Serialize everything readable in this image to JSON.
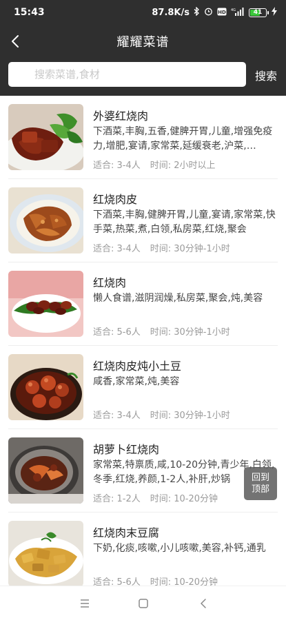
{
  "status_bar": {
    "time": "15:43",
    "net_speed": "87.8K/s",
    "battery": "41",
    "icons": [
      "bluetooth-icon",
      "alarm-icon",
      "hd-icon",
      "signal-4g-icon",
      "battery-icon",
      "charging-icon"
    ]
  },
  "header": {
    "title": "耀耀菜谱",
    "back_icon": "chevron-left-icon"
  },
  "search": {
    "placeholder": "搜索菜谱,食材",
    "button_label": "搜索"
  },
  "recipes": [
    {
      "title": "外婆红烧肉",
      "tags": "下酒菜,丰胸,五香,健脾开胃,儿童,增强免疫力,增肥,宴请,家常菜,延缓衰老,沪菜,…",
      "serves_label": "适合: 3-4人",
      "time_label": "时间: 2小时以上",
      "image": "braised-pork-with-greens-photo"
    },
    {
      "title": "红烧肉皮",
      "tags": "下酒菜,丰胸,健脾开胃,儿童,宴请,家常菜,快手菜,热菜,煮,白领,私房菜,红烧,聚会",
      "serves_label": "适合: 3-4人",
      "time_label": "时间: 30分钟-1小时",
      "image": "braised-pork-skin-photo"
    },
    {
      "title": "红烧肉",
      "tags": "懒人食谱,滋阴润燥,私房菜,聚会,炖,美容",
      "serves_label": "适合: 5-6人",
      "time_label": "时间: 30分钟-1小时",
      "image": "braised-pork-plate-photo"
    },
    {
      "title": "红烧肉皮炖小土豆",
      "tags": "咸香,家常菜,炖,美容",
      "serves_label": "适合: 3-4人",
      "time_label": "时间: 30分钟-1小时",
      "image": "pork-skin-potatoes-photo"
    },
    {
      "title": "胡萝卜红烧肉",
      "tags": "家常菜,特禀质,咸,10-20分钟,青少年,白领,冬季,红烧,养颜,1-2人,补肝,炒锅",
      "serves_label": "适合: 1-2人",
      "time_label": "时间: 10-20分钟",
      "image": "carrot-braised-pork-pot-photo"
    },
    {
      "title": "红烧肉末豆腐",
      "tags": "下奶,化痰,咳嗽,小儿咳嗽,美容,补钙,通乳",
      "serves_label": "适合: 5-6人",
      "time_label": "时间: 10-20分钟",
      "image": "minced-pork-tofu-photo"
    }
  ],
  "back_to_top": {
    "line1": "回到",
    "line2": "顶部"
  },
  "nav_bar": {
    "icons": [
      "menu-icon",
      "home-square-icon",
      "back-triangle-icon"
    ]
  },
  "colors": {
    "header_bg": "#2f2f2f",
    "meta_text": "#9a9a9a",
    "battery_fill": "#3cc83c"
  }
}
